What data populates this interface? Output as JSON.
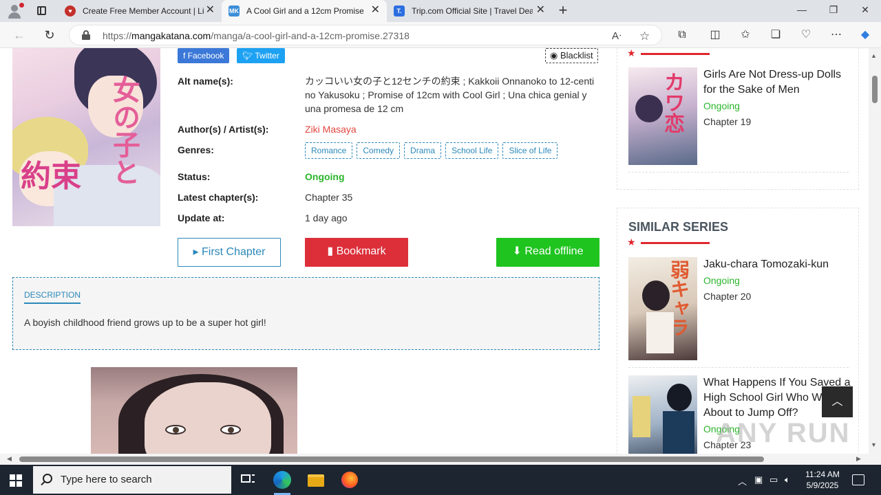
{
  "browser": {
    "tabs": [
      {
        "title": "Create Free Member Account | Li",
        "favicon": "red-chat-icon",
        "color": "#c4302b"
      },
      {
        "title": "A Cool Girl and a 12cm Promise",
        "favicon": "MK",
        "color": "#3d8ed8"
      },
      {
        "title": "Trip.com Official Site | Travel Deal",
        "favicon": "T.",
        "color": "#2b6ee0"
      }
    ],
    "url_prefix": "https://",
    "url_host": "mangakatana.com",
    "url_path": "/manga/a-cool-girl-and-a-12cm-promise.27318"
  },
  "manga": {
    "share_facebook": "Facebook",
    "share_twitter": "Twitter",
    "blacklist": "Blacklist",
    "alt_label": "Alt name(s):",
    "alt_value": "カッコいい女の子と12センチの約束 ; Kakkoii Onnanoko to 12-centi no Yakusoku ; Promise of 12cm with Cool Girl ; Una chica genial y una promesa de 12 cm",
    "author_label": "Author(s) / Artist(s):",
    "author_value": "Ziki Masaya",
    "genres_label": "Genres:",
    "genres": [
      "Romance",
      "Comedy",
      "Drama",
      "School Life",
      "Slice of Life"
    ],
    "status_label": "Status:",
    "status_value": "Ongoing",
    "latest_label": "Latest chapter(s):",
    "latest_value": "Chapter 35",
    "update_label": "Update at:",
    "update_value": "1 day ago",
    "btn_first": "First Chapter",
    "btn_bookmark": "Bookmark",
    "btn_offline": "Read offline",
    "desc_heading": "DESCRIPTION",
    "desc_text": "A boyish childhood friend grows up to be a super hot girl!"
  },
  "sidebar": {
    "top_item": {
      "title": "Girls Are Not Dress-up Dolls for the Sake of Men",
      "status": "Ongoing",
      "chapter": "Chapter 19"
    },
    "similar_heading": "SIMILAR SERIES",
    "similar": [
      {
        "title": "Jaku-chara Tomozaki-kun",
        "status": "Ongoing",
        "chapter": "Chapter 20"
      },
      {
        "title": "What Happens If You Saved a High School Girl Who Was About to Jump Off?",
        "status": "Ongoing",
        "chapter": "Chapter 23"
      }
    ]
  },
  "taskbar": {
    "search_placeholder": "Type here to search",
    "time": "11:24 AM",
    "date": "5/9/2025"
  },
  "watermark": "ANY RUN",
  "colors": {
    "accent": "#2a87b8",
    "ongoing": "#2bb52b",
    "bookmark": "#dc2f3a",
    "offline": "#1fc41f"
  }
}
